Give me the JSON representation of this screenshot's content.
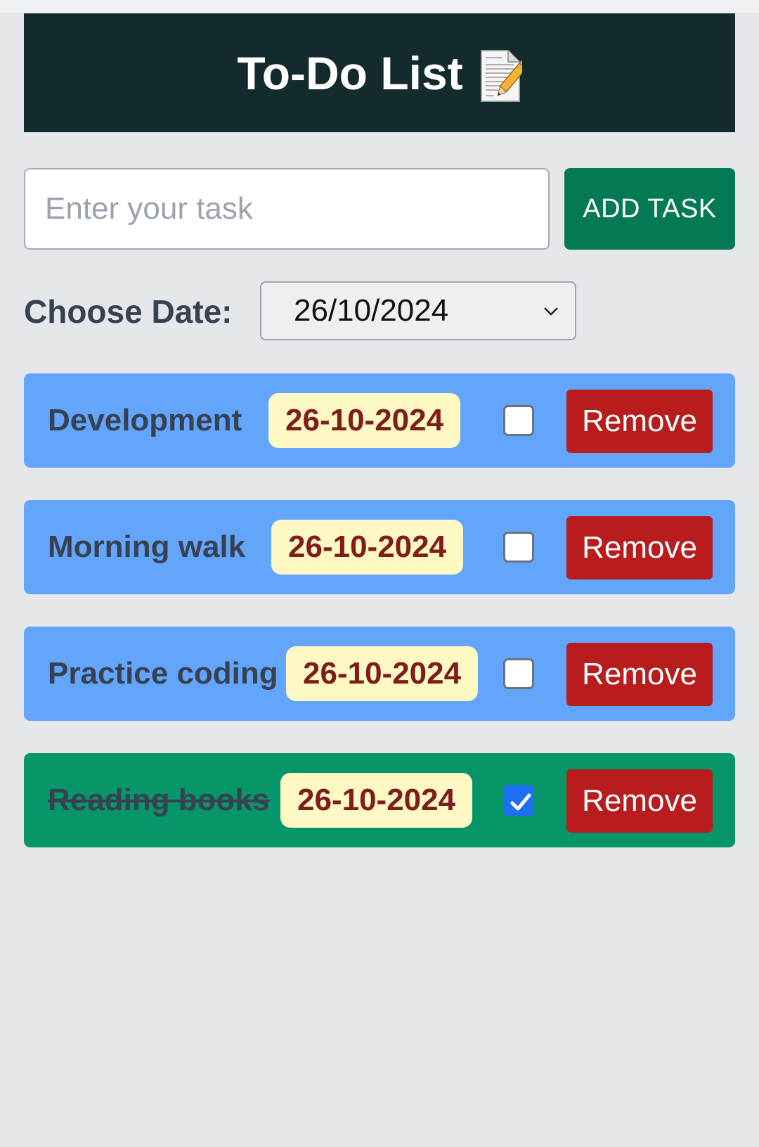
{
  "header": {
    "title": "To-Do List",
    "icon": "memo-icon"
  },
  "input": {
    "placeholder": "Enter your task",
    "value": "",
    "add_label": "ADD TASK"
  },
  "date_picker": {
    "label": "Choose Date:",
    "selected": "26/10/2024"
  },
  "tasks": [
    {
      "name": "Development",
      "date": "26-10-2024",
      "checked": false,
      "remove_label": "Remove"
    },
    {
      "name": "Morning walk",
      "date": "26-10-2024",
      "checked": false,
      "remove_label": "Remove"
    },
    {
      "name": "Practice coding",
      "date": "26-10-2024",
      "checked": false,
      "remove_label": "Remove"
    },
    {
      "name": "Reading books",
      "date": "26-10-2024",
      "checked": true,
      "remove_label": "Remove"
    }
  ],
  "colors": {
    "header_bg": "#142b2e",
    "add_button": "#037a55",
    "task_pending_bg": "#63a5fa",
    "task_done_bg": "#079669",
    "date_badge_bg": "#fef9c3",
    "date_badge_text": "#7f1d1d",
    "remove_button": "#b91c1c"
  }
}
